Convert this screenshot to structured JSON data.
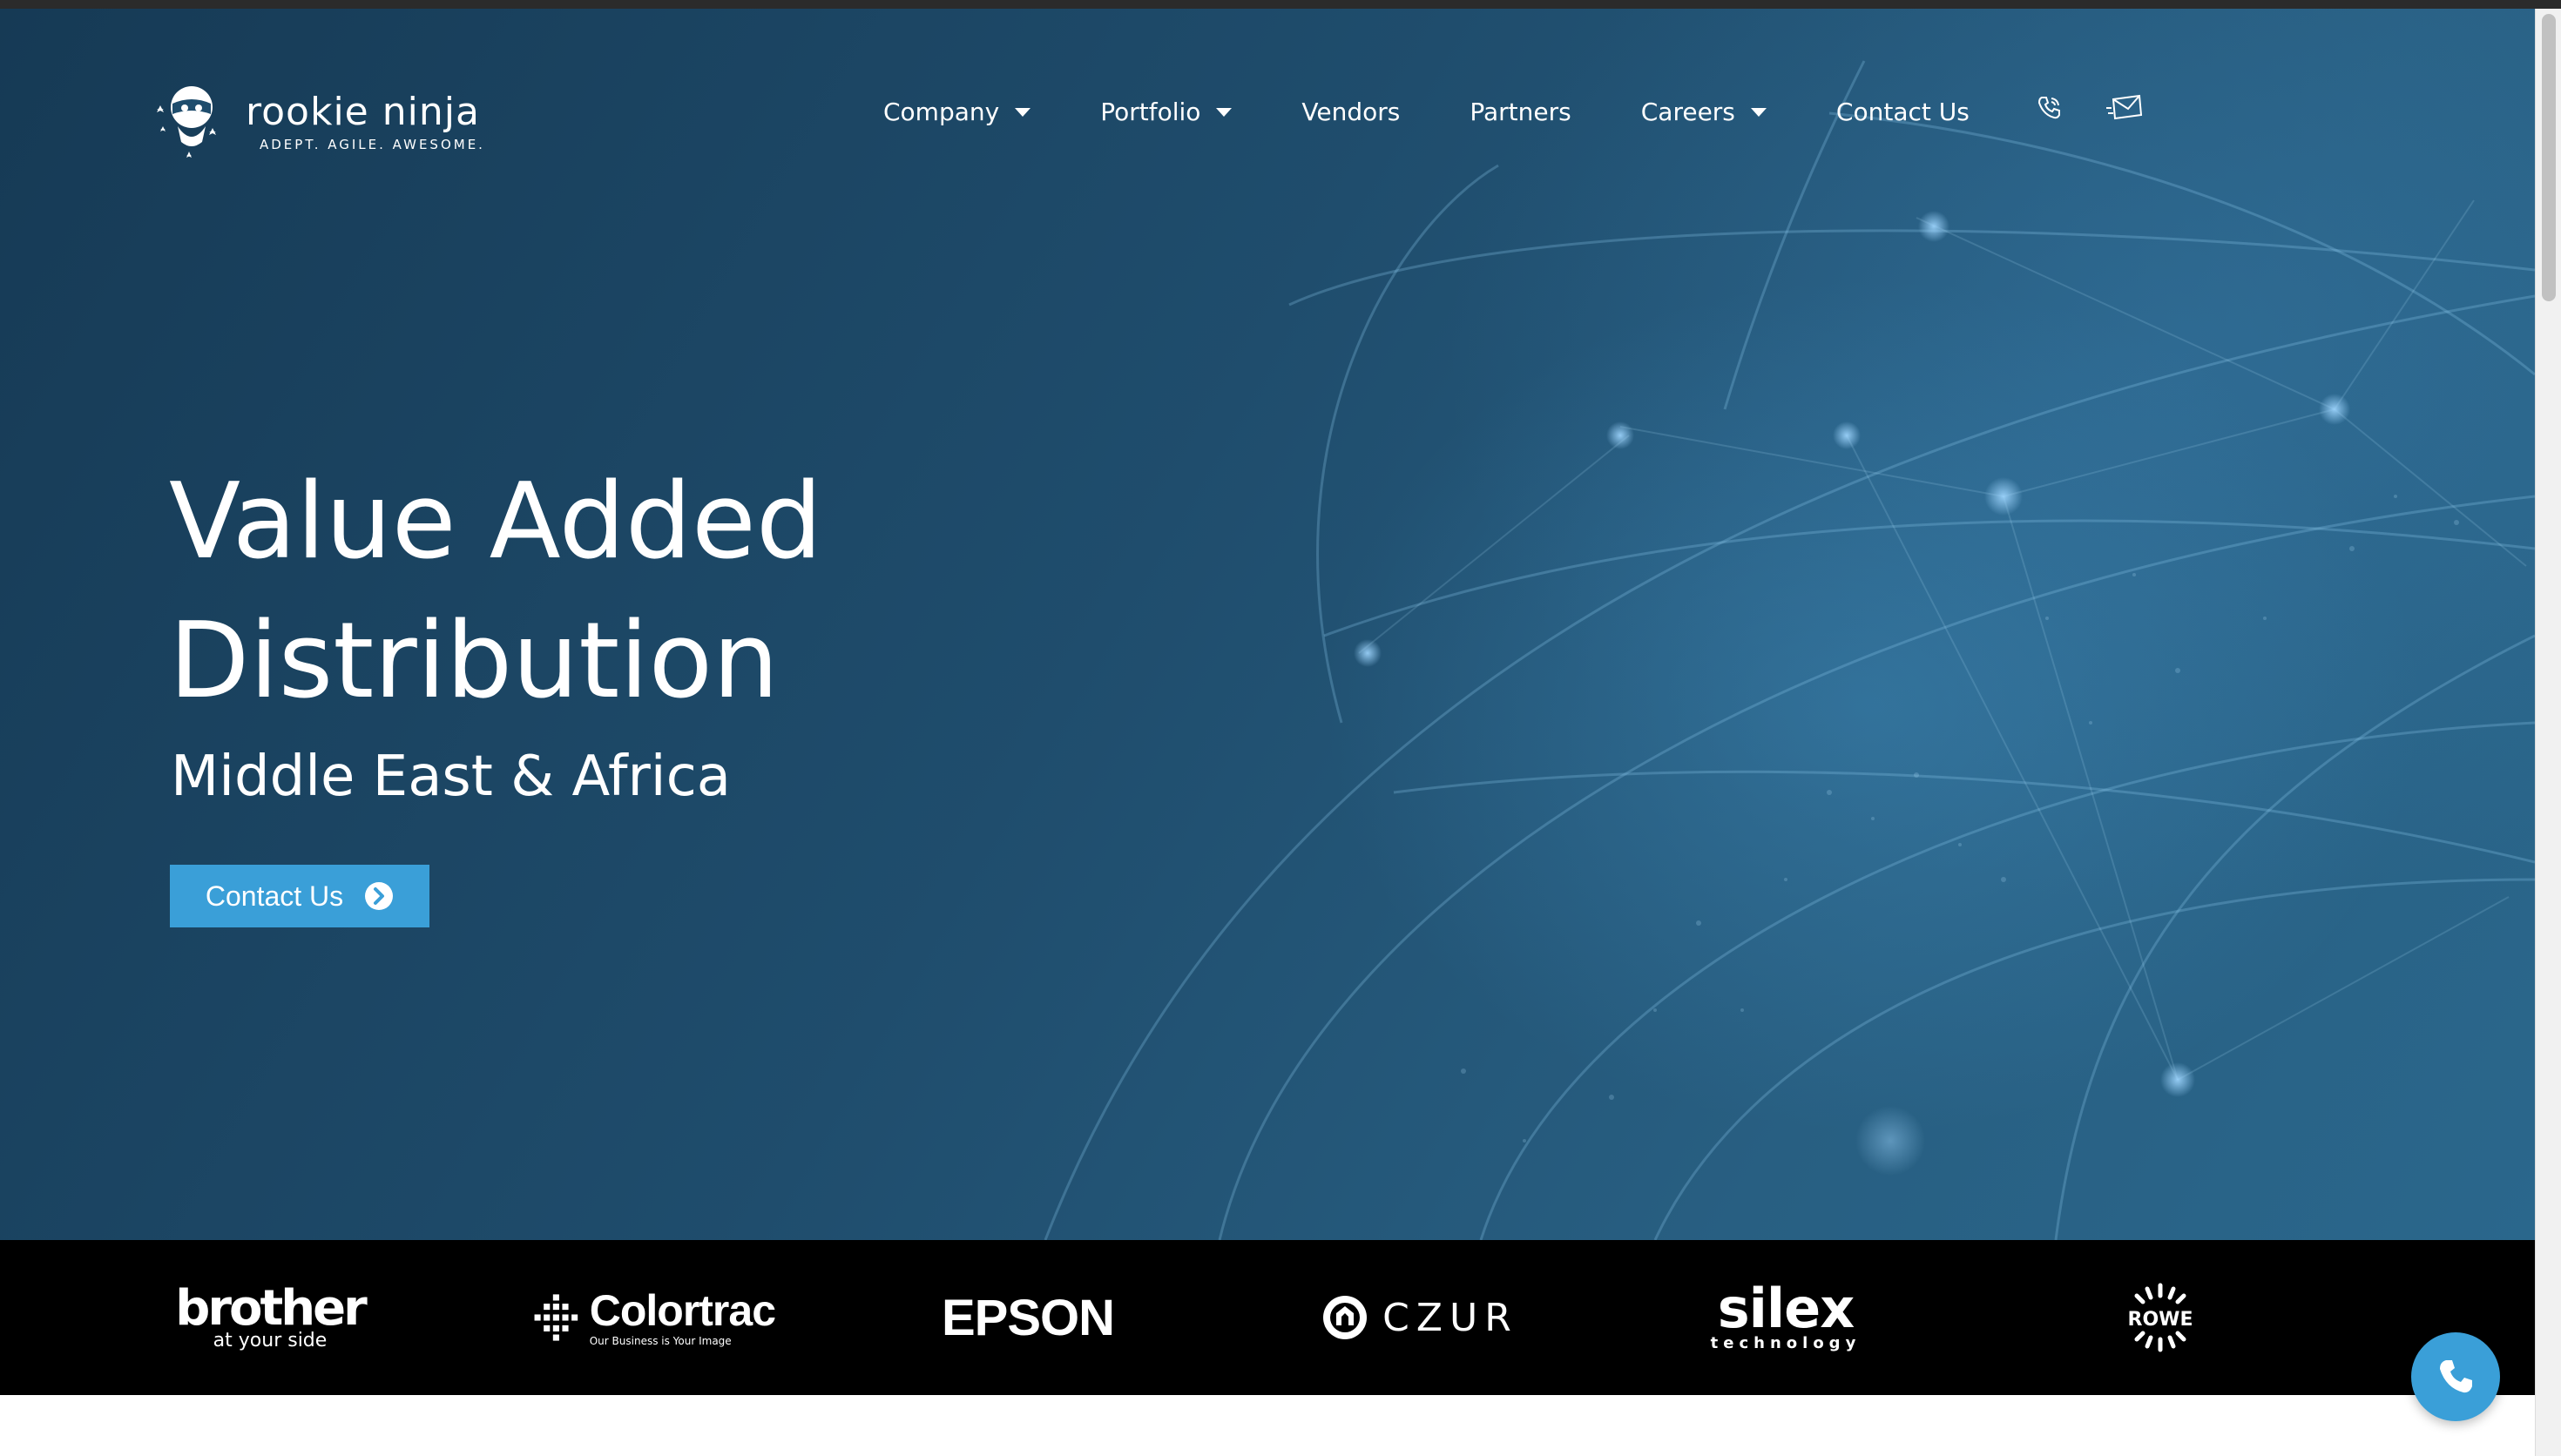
{
  "brand": {
    "name": "rookie ninja",
    "tagline": "ADEPT. AGILE. AWESOME."
  },
  "nav": {
    "items": [
      {
        "label": "Company",
        "has_dropdown": true
      },
      {
        "label": "Portfolio",
        "has_dropdown": true
      },
      {
        "label": "Vendors",
        "has_dropdown": false
      },
      {
        "label": "Partners",
        "has_dropdown": false
      },
      {
        "label": "Careers",
        "has_dropdown": true
      },
      {
        "label": "Contact Us",
        "has_dropdown": false
      }
    ],
    "icons": [
      "phone-icon",
      "email-icon"
    ]
  },
  "hero": {
    "title_line1": "Value Added",
    "title_line2": "Distribution",
    "subtitle": "Middle East & Africa",
    "cta_label": "Contact Us",
    "cta_icon": "chevron-circle-right-icon"
  },
  "vendors": {
    "brother": {
      "name": "brother",
      "tagline": "at your side"
    },
    "colortrac": {
      "name": "Colortrac",
      "tagline": "Our Business is Your Image"
    },
    "epson": {
      "name": "EPSON"
    },
    "czur": {
      "name": "CZUR"
    },
    "silex": {
      "name": "silex",
      "tagline": "technology"
    },
    "rowe": {
      "name": "ROWE"
    }
  },
  "floating": {
    "icon": "phone-icon"
  },
  "colors": {
    "hero_dark": "#163a55",
    "hero_light": "#2a678c",
    "accent": "#3a9fd8",
    "vendor_strip": "#000000",
    "text": "#ffffff"
  }
}
